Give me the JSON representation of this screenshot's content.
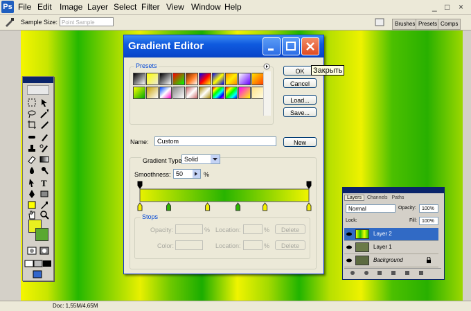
{
  "menu": {
    "app_icon": "Ps",
    "items": [
      "File",
      "Edit",
      "Image",
      "Layer",
      "Select",
      "Filter",
      "View",
      "Window",
      "Help"
    ],
    "window_controls": {
      "min": "_",
      "restore": "□",
      "close": "×"
    }
  },
  "options_bar": {
    "sample_size_label": "Sample Size:",
    "sample_size_value": "Point Sample",
    "wells": [
      "Brushes",
      "Presets",
      "Comps"
    ]
  },
  "statusbar": {
    "doc": "Doc: 1,55M/4,65M"
  },
  "dialog": {
    "title": "Gradient Editor",
    "presets_label": "Presets",
    "buttons": {
      "ok": "OK",
      "cancel": "Cancel",
      "load": "Load...",
      "save": "Save...",
      "new": "New"
    },
    "tooltip": "Закрыть",
    "name_label": "Name:",
    "name_value": "Custom",
    "gradient_type_label": "Gradient Type:",
    "gradient_type_value": "Solid",
    "smoothness_label": "Smoothness:",
    "smoothness_value": "50",
    "smoothness_unit": "%",
    "stops_label": "Stops",
    "opacity_label": "Opacity:",
    "color_label": "Color:",
    "location_label": "Location:",
    "percent": "%",
    "delete_label": "Delete",
    "preset_swatches": [
      "linear-gradient(135deg,#000,#fff)",
      "linear-gradient(135deg,#ff0,rgba(255,255,0,0))",
      "linear-gradient(135deg,#000,#fff)",
      "linear-gradient(135deg,#ff0000,#00ff00)",
      "linear-gradient(135deg,#7a2a00,#ff7a20,#fff)",
      "linear-gradient(135deg,#0000ff,#ff0000,#ffff00)",
      "linear-gradient(135deg,#0000ff,#ffff00,#0000ff)",
      "linear-gradient(135deg,#ff8800,#ffee00,#ff8800)",
      "linear-gradient(135deg,#fff,#6a00ff)",
      "linear-gradient(135deg,#ffe100,#ff4000)",
      "linear-gradient(135deg,#ff0,#0a0)",
      "linear-gradient(135deg,#c8a000,#fff)",
      "linear-gradient(135deg,#004cff,#fff,#ff00c8)",
      "linear-gradient(135deg,#888,#fff)",
      "linear-gradient(135deg,#c66,#fff,#c66)",
      "linear-gradient(135deg,#a88a00,#fff,#a88a00)",
      "linear-gradient(135deg,#f00,#ff0,#0f0,#0ff,#00f,#f0f)",
      "linear-gradient(135deg,#f00,#ff0,#0f0,#0ff,#00f)",
      "linear-gradient(135deg,#f0f,#ff0)",
      "linear-gradient(135deg,#ffe38a,#fffbe0)"
    ],
    "gradient_colors": {
      "start": "#e8f100",
      "mid": "#28b400",
      "end": "#f0f400"
    },
    "stops": {
      "opacity": [
        0,
        100
      ],
      "color": [
        0,
        17,
        40,
        58,
        74,
        100
      ]
    }
  },
  "layers_panel": {
    "tabs": [
      "Layers",
      "Channels",
      "Paths"
    ],
    "blend_mode": "Normal",
    "opacity_label": "Opacity:",
    "opacity_value": "100%",
    "fill_label": "Fill:",
    "fill_value": "100%",
    "lock_label": "Lock:",
    "layers": [
      {
        "name": "Layer 2",
        "selected": true
      },
      {
        "name": "Layer 1",
        "selected": false
      },
      {
        "name": "Background",
        "selected": false
      }
    ]
  }
}
